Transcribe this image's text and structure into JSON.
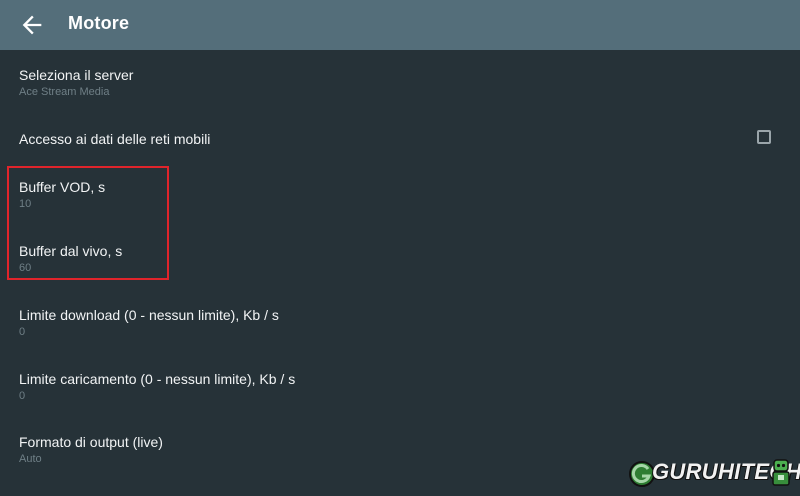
{
  "header": {
    "back_icon": "arrow-back-icon",
    "title": "Motore",
    "background": "#546e7a"
  },
  "settings": [
    {
      "label": "Seleziona il server",
      "value": "Ace Stream Media"
    },
    {
      "label": "Accesso ai dati delle reti mobili",
      "value": "",
      "checked": false
    },
    {
      "label": "Buffer VOD, s",
      "value": "10"
    },
    {
      "label": "Buffer dal vivo, s",
      "value": "60"
    },
    {
      "label": "Limite download (0 - nessun limite), Kb / s",
      "value": "0"
    },
    {
      "label": "Limite caricamento (0 - nessun limite), Kb / s",
      "value": "0"
    },
    {
      "label": "Formato di output (live)",
      "value": "Auto"
    }
  ],
  "annotation": {
    "highlight_color": "#e0242b"
  },
  "watermark": {
    "text": "GURUHITECH"
  },
  "colors": {
    "background": "#263238",
    "label": "#f2f4f5",
    "secondary": "#6f7f86"
  }
}
